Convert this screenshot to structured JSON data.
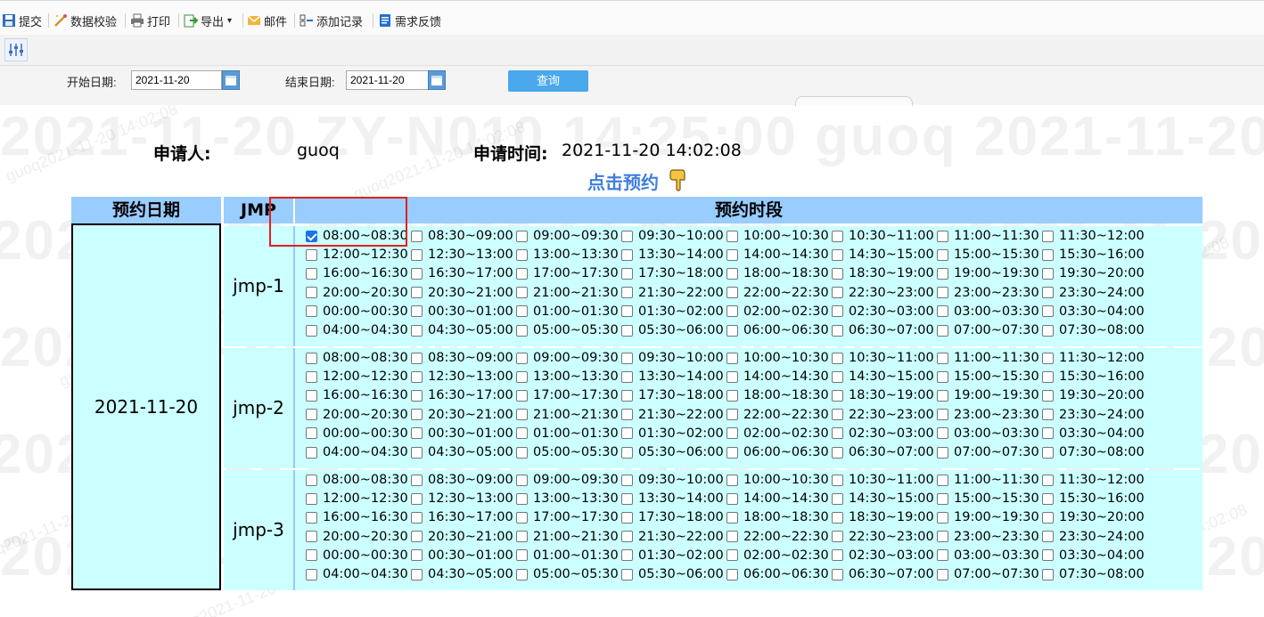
{
  "toolbar": {
    "items": [
      {
        "label": "提交",
        "icon": "save-icon"
      },
      {
        "label": "数据校验",
        "icon": "wand-icon"
      },
      {
        "label": "打印",
        "icon": "printer-icon"
      },
      {
        "label": "导出",
        "icon": "export-icon",
        "dropdown": true
      },
      {
        "label": "邮件",
        "icon": "mail-icon"
      },
      {
        "label": "添加记录",
        "icon": "add-record-icon"
      },
      {
        "label": "需求反馈",
        "icon": "feedback-icon"
      }
    ],
    "dropdown_glyph": "▾"
  },
  "watermark": {
    "banner": "2021-11-20 ZY-N010 14:25:00 guoq 2021-11-20",
    "tile": "guoq2021-11-20 14:02:08"
  },
  "query": {
    "start_label": "开始日期:",
    "start_value": "2021-11-20",
    "end_label": "结束日期:",
    "end_value": "2021-11-20",
    "button_label": "查询"
  },
  "applicant": {
    "label": "申请人:",
    "name": "guoq",
    "time_label": "申请时间:",
    "time_value": "2021-11-20 14:02:08"
  },
  "cta": {
    "label": "点击预约",
    "icon": "pointing-hand-icon"
  },
  "table": {
    "headers": {
      "date": "预约日期",
      "jmp": "JMP",
      "slots": "预约时段"
    },
    "date": "2021-11-20",
    "slots": [
      "08:00~08:30",
      "08:30~09:00",
      "09:00~09:30",
      "09:30~10:00",
      "10:00~10:30",
      "10:30~11:00",
      "11:00~11:30",
      "11:30~12:00",
      "12:00~12:30",
      "12:30~13:00",
      "13:00~13:30",
      "13:30~14:00",
      "14:00~14:30",
      "14:30~15:00",
      "15:00~15:30",
      "15:30~16:00",
      "16:00~16:30",
      "16:30~17:00",
      "17:00~17:30",
      "17:30~18:00",
      "18:00~18:30",
      "18:30~19:00",
      "19:00~19:30",
      "19:30~20:00",
      "20:00~20:30",
      "20:30~21:00",
      "21:00~21:30",
      "21:30~22:00",
      "22:00~22:30",
      "22:30~23:00",
      "23:00~23:30",
      "23:30~24:00",
      "00:00~00:30",
      "00:30~01:00",
      "01:00~01:30",
      "01:30~02:00",
      "02:00~02:30",
      "02:30~03:00",
      "03:00~03:30",
      "03:30~04:00",
      "04:00~04:30",
      "04:30~05:00",
      "05:00~05:30",
      "05:30~06:00",
      "06:00~06:30",
      "06:30~07:00",
      "07:00~07:30",
      "07:30~08:00"
    ],
    "jmps": [
      {
        "name": "jmp-1",
        "checked": [
          "08:00~08:30"
        ]
      },
      {
        "name": "jmp-2",
        "checked": []
      },
      {
        "name": "jmp-3",
        "checked": []
      }
    ]
  },
  "colors": {
    "header_bg": "#99ccff",
    "cell_bg": "#ccffff",
    "query_button": "#4aa8ec",
    "cta_text": "#3e7fde",
    "highlight_box": "#e02020"
  }
}
